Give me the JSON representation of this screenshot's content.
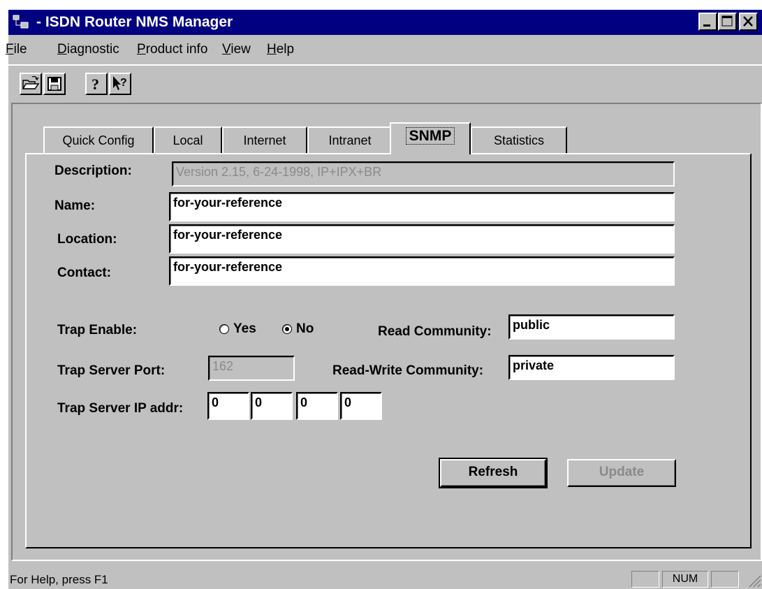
{
  "window": {
    "title": "- ISDN Router NMS Manager"
  },
  "menu": [
    {
      "mnemonic": "F",
      "rest": "ile"
    },
    {
      "mnemonic": "D",
      "rest": "iagnostic"
    },
    {
      "mnemonic": "P",
      "rest": "roduct info"
    },
    {
      "mnemonic": "V",
      "rest": "iew"
    },
    {
      "mnemonic": "H",
      "rest": "elp"
    }
  ],
  "toolbar": {
    "buttons": [
      "open-folder-icon",
      "save-disk-icon",
      "help-question-icon",
      "context-help-icon"
    ],
    "help_glyph": "?"
  },
  "tabs": [
    "Quick Config",
    "Local",
    "Internet",
    "Intranet",
    "SNMP",
    "Statistics"
  ],
  "active_tab": "SNMP",
  "form": {
    "description_label": "Description:",
    "description_value": "Version 2.15, 6-24-1998, IP+IPX+BR",
    "name_label": "Name:",
    "name_value": "for-your-reference",
    "location_label": "Location:",
    "location_value": "for-your-reference",
    "contact_label": "Contact:",
    "contact_value": "for-your-reference",
    "trap_enable_label": "Trap Enable:",
    "trap_yes_label": "Yes",
    "trap_no_label": "No",
    "trap_selected": "No",
    "read_community_label": "Read Community:",
    "read_community_value": "public",
    "trap_port_label": "Trap Server Port:",
    "trap_port_value": "162",
    "rw_community_label": "Read-Write Community:",
    "rw_community_value": "private",
    "trap_ip_label": "Trap Server IP addr:",
    "ip": [
      "0",
      "0",
      "0",
      "0"
    ]
  },
  "buttons": {
    "refresh": "Refresh",
    "update": "Update"
  },
  "status": {
    "text": "For Help, press F1",
    "num": "NUM"
  },
  "colors": {
    "titlebar": "#000080",
    "face": "#c0c0c0",
    "disabled_text": "#8a8a8a"
  }
}
